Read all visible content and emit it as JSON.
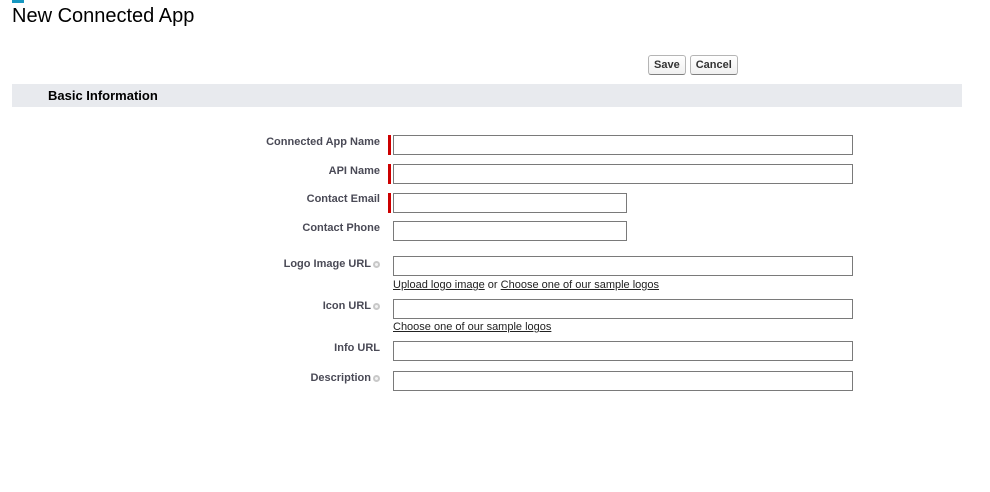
{
  "page": {
    "title": "New Connected App"
  },
  "toolbar": {
    "save_label": "Save",
    "cancel_label": "Cancel"
  },
  "section": {
    "title": "Basic Information"
  },
  "fields": {
    "app_name": {
      "label": "Connected App Name",
      "value": "",
      "required": true
    },
    "api_name": {
      "label": "API Name",
      "value": "",
      "required": true
    },
    "contact_email": {
      "label": "Contact Email",
      "value": "",
      "required": true
    },
    "contact_phone": {
      "label": "Contact Phone",
      "value": ""
    },
    "logo_url": {
      "label": "Logo Image URL",
      "value": ""
    },
    "icon_url": {
      "label": "Icon URL",
      "value": ""
    },
    "info_url": {
      "label": "Info URL",
      "value": ""
    },
    "description": {
      "label": "Description",
      "value": ""
    }
  },
  "links": {
    "upload_logo": "Upload logo image",
    "or": "or",
    "choose_sample_logos": "Choose one of our sample logos",
    "choose_sample_logos_icon": "Choose one of our sample logos"
  },
  "icons": {
    "help": "help-icon",
    "title_accent": "title-accent"
  },
  "colors": {
    "required": "#cc0000",
    "section_bg": "#e8eaee",
    "label": "#4a4a56"
  }
}
